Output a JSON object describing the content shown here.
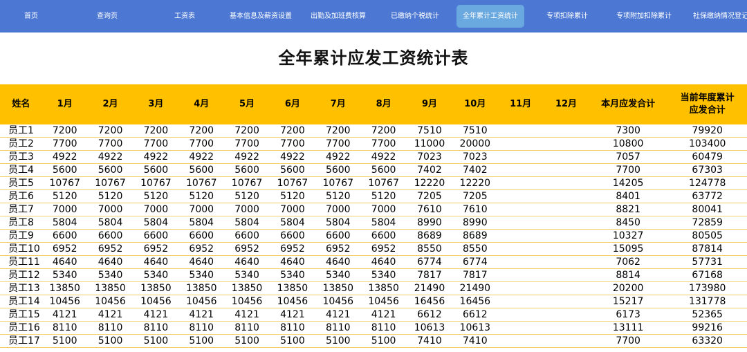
{
  "nav": [
    "首页",
    "查询页",
    "工资表",
    "基本信息及薪资设置",
    "出勤及加班费核算",
    "已缴纳个税统计",
    "全年累计工资统计",
    "专项扣除累计",
    "专项附加扣除累计",
    "社保缴纳情况登记"
  ],
  "active_nav": 6,
  "title": "全年累计应发工资统计表",
  "headers": [
    "姓名",
    "1月",
    "2月",
    "3月",
    "4月",
    "5月",
    "6月",
    "7月",
    "8月",
    "9月",
    "10月",
    "11月",
    "12月",
    "本月应发合计",
    "当前年度累计\n应发合计"
  ],
  "rows": [
    [
      "员工1",
      "7200",
      "7200",
      "7200",
      "7200",
      "7200",
      "7200",
      "7200",
      "7200",
      "7510",
      "7510",
      "",
      "",
      "7300",
      "79920"
    ],
    [
      "员工2",
      "7700",
      "7700",
      "7700",
      "7700",
      "7700",
      "7700",
      "7700",
      "7700",
      "11000",
      "20000",
      "",
      "",
      "10800",
      "103400"
    ],
    [
      "员工3",
      "4922",
      "4922",
      "4922",
      "4922",
      "4922",
      "4922",
      "4922",
      "4922",
      "7023",
      "7023",
      "",
      "",
      "7057",
      "60479"
    ],
    [
      "员工4",
      "5600",
      "5600",
      "5600",
      "5600",
      "5600",
      "5600",
      "5600",
      "5600",
      "7402",
      "7402",
      "",
      "",
      "7700",
      "67303"
    ],
    [
      "员工5",
      "10767",
      "10767",
      "10767",
      "10767",
      "10767",
      "10767",
      "10767",
      "10767",
      "12220",
      "12220",
      "",
      "",
      "14205",
      "124778"
    ],
    [
      "员工6",
      "5120",
      "5120",
      "5120",
      "5120",
      "5120",
      "5120",
      "5120",
      "5120",
      "7205",
      "7205",
      "",
      "",
      "8401",
      "63772"
    ],
    [
      "员工7",
      "7000",
      "7000",
      "7000",
      "7000",
      "7000",
      "7000",
      "7000",
      "7000",
      "7610",
      "7610",
      "",
      "",
      "8821",
      "80041"
    ],
    [
      "员工8",
      "5804",
      "5804",
      "5804",
      "5804",
      "5804",
      "5804",
      "5804",
      "5804",
      "8990",
      "8990",
      "",
      "",
      "8450",
      "72859"
    ],
    [
      "员工9",
      "6600",
      "6600",
      "6600",
      "6600",
      "6600",
      "6600",
      "6600",
      "6600",
      "8689",
      "8689",
      "",
      "",
      "10327",
      "80505"
    ],
    [
      "员工10",
      "6952",
      "6952",
      "6952",
      "6952",
      "6952",
      "6952",
      "6952",
      "6952",
      "8550",
      "8550",
      "",
      "",
      "15095",
      "87814"
    ],
    [
      "员工11",
      "4640",
      "4640",
      "4640",
      "4640",
      "4640",
      "4640",
      "4640",
      "4640",
      "6774",
      "6774",
      "",
      "",
      "7062",
      "57731"
    ],
    [
      "员工12",
      "5340",
      "5340",
      "5340",
      "5340",
      "5340",
      "5340",
      "5340",
      "5340",
      "7817",
      "7817",
      "",
      "",
      "8814",
      "67168"
    ],
    [
      "员工13",
      "13850",
      "13850",
      "13850",
      "13850",
      "13850",
      "13850",
      "13850",
      "13850",
      "21490",
      "21490",
      "",
      "",
      "20200",
      "173980"
    ],
    [
      "员工14",
      "10456",
      "10456",
      "10456",
      "10456",
      "10456",
      "10456",
      "10456",
      "10456",
      "16456",
      "16456",
      "",
      "",
      "15217",
      "131778"
    ],
    [
      "员工15",
      "4121",
      "4121",
      "4121",
      "4121",
      "4121",
      "4121",
      "4121",
      "4121",
      "6612",
      "6612",
      "",
      "",
      "6173",
      "52365"
    ],
    [
      "员工16",
      "8110",
      "8110",
      "8110",
      "8110",
      "8110",
      "8110",
      "8110",
      "8110",
      "10613",
      "10613",
      "",
      "",
      "13111",
      "99216"
    ],
    [
      "员工17",
      "5100",
      "5100",
      "5100",
      "5100",
      "5100",
      "5100",
      "5100",
      "5100",
      "7410",
      "7410",
      "",
      "",
      "7700",
      "63320"
    ]
  ]
}
